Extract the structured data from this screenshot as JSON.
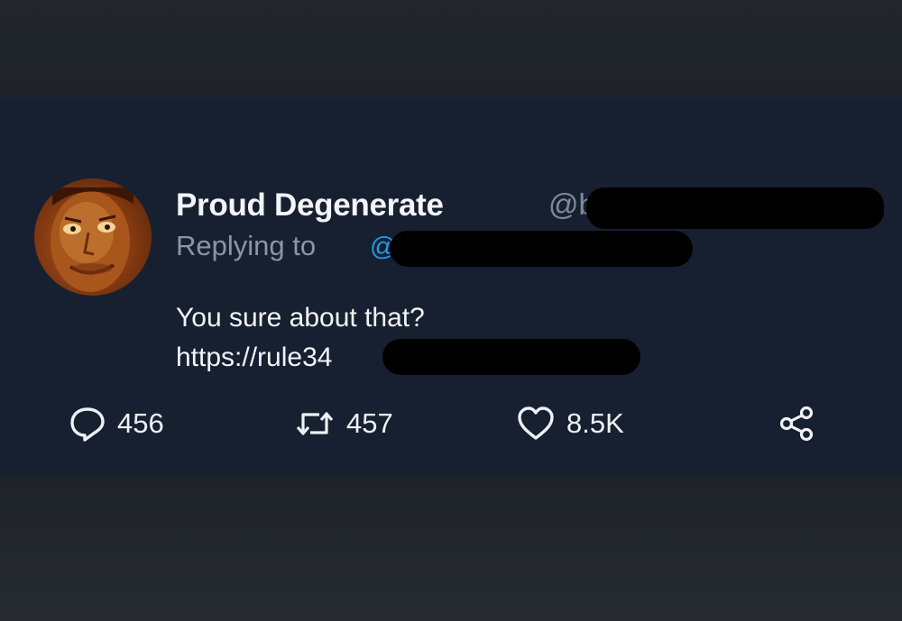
{
  "tweet": {
    "author_name": "Proud Degenerate",
    "author_handle": "@b",
    "replying_label": "Replying to",
    "reply_handle": "@",
    "text_line1": "You sure about that?",
    "text_line2": "https://rule34",
    "actions": {
      "reply_count": "456",
      "retweet_count": "457",
      "like_count": "8.5K"
    }
  },
  "icons": {
    "reply": "reply-icon",
    "retweet": "retweet-icon",
    "like": "heart-icon",
    "share": "share-icon"
  },
  "colors": {
    "tweet_bg": "#172030",
    "page_bg": "#1d2128",
    "text": "#f2f4f7",
    "muted": "#8a95a5",
    "link": "#1d9bf0"
  }
}
